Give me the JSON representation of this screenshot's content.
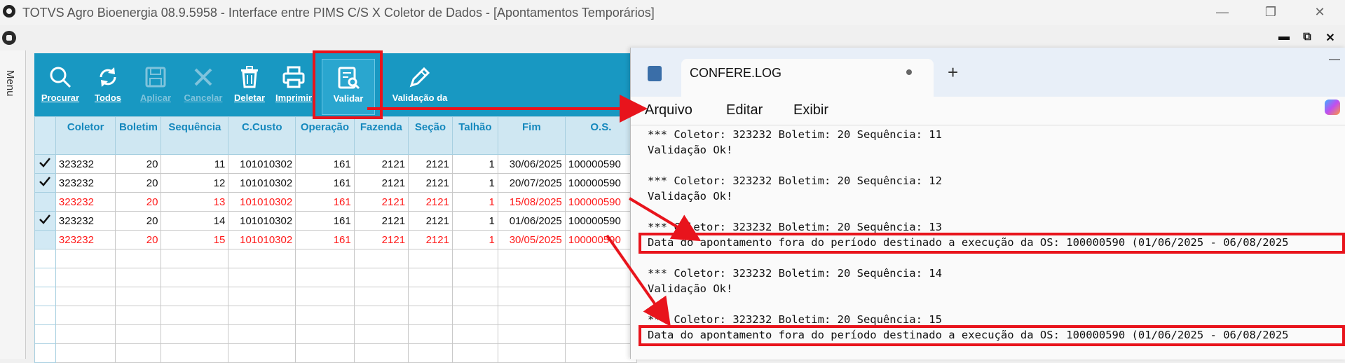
{
  "window": {
    "title": "TOTVS Agro Bioenergia 08.9.5958 - Interface entre PIMS C/S X Coletor de Dados - [Apontamentos Temporários]",
    "controls": [
      "—",
      "❐",
      "✕"
    ],
    "mdi_controls": [
      "▬",
      "⧉",
      "✕"
    ]
  },
  "side_menu": {
    "label": "Menu"
  },
  "toolbar": [
    {
      "label": "Procurar",
      "icon": "search-icon",
      "enabled": true
    },
    {
      "label": "Todos",
      "icon": "refresh-icon",
      "enabled": true
    },
    {
      "label": "Aplicar",
      "icon": "save-icon",
      "enabled": false
    },
    {
      "label": "Cancelar",
      "icon": "cancel-icon",
      "enabled": false
    },
    {
      "label": "Deletar",
      "icon": "trash-icon",
      "enabled": true
    },
    {
      "label": "Imprimir",
      "icon": "printer-icon",
      "enabled": true
    },
    {
      "label": "Validar",
      "icon": "validate-icon",
      "enabled": true
    },
    {
      "label": "Validação da",
      "icon": "pencil-icon",
      "enabled": true
    }
  ],
  "grid": {
    "columns": [
      "Coletor",
      "Boletim",
      "Sequência",
      "C.Custo",
      "Operação",
      "Fazenda",
      "Seção",
      "Talhão",
      "Fim",
      "O.S."
    ],
    "rows": [
      {
        "check": true,
        "error": false,
        "cells": [
          "323232",
          "20",
          "11",
          "101010302",
          "161",
          "2121",
          "2121",
          "1",
          "30/06/2025",
          "100000590"
        ]
      },
      {
        "check": true,
        "error": false,
        "cells": [
          "323232",
          "20",
          "12",
          "101010302",
          "161",
          "2121",
          "2121",
          "1",
          "20/07/2025",
          "100000590"
        ]
      },
      {
        "check": false,
        "error": true,
        "cells": [
          "323232",
          "20",
          "13",
          "101010302",
          "161",
          "2121",
          "2121",
          "1",
          "15/08/2025",
          "100000590"
        ]
      },
      {
        "check": true,
        "error": false,
        "cells": [
          "323232",
          "20",
          "14",
          "101010302",
          "161",
          "2121",
          "2121",
          "1",
          "01/06/2025",
          "100000590"
        ]
      },
      {
        "check": false,
        "error": true,
        "cells": [
          "323232",
          "20",
          "15",
          "101010302",
          "161",
          "2121",
          "2121",
          "1",
          "30/05/2025",
          "100000590"
        ]
      }
    ],
    "empty_rows": 6,
    "error_color": "#ff1a1a"
  },
  "notepad": {
    "tab_title": "CONFERE.LOG",
    "new_tab": "+",
    "menu": [
      "Arquivo",
      "Editar",
      "Exibir"
    ],
    "lines": [
      "*** Coletor: 323232 Boletim: 20 Sequência: 11",
      "Validação Ok!",
      "",
      "*** Coletor: 323232 Boletim: 20 Sequência: 12",
      "Validação Ok!",
      "",
      "*** Coletor: 323232 Boletim: 20 Sequência: 13",
      "Data do apontamento fora do período destinado a execução da OS: 100000590 (01/06/2025 - 06/08/2025",
      "",
      "*** Coletor: 323232 Boletim: 20 Sequência: 14",
      "Validação Ok!",
      "",
      "*** Coletor: 323232 Boletim: 20 Sequência: 15",
      "Data do apontamento fora do período destinado a execução da OS: 100000590 (01/06/2025 - 06/08/2025"
    ]
  },
  "annotation_color": "#e8141c",
  "toolbar_color": "#1898c2"
}
